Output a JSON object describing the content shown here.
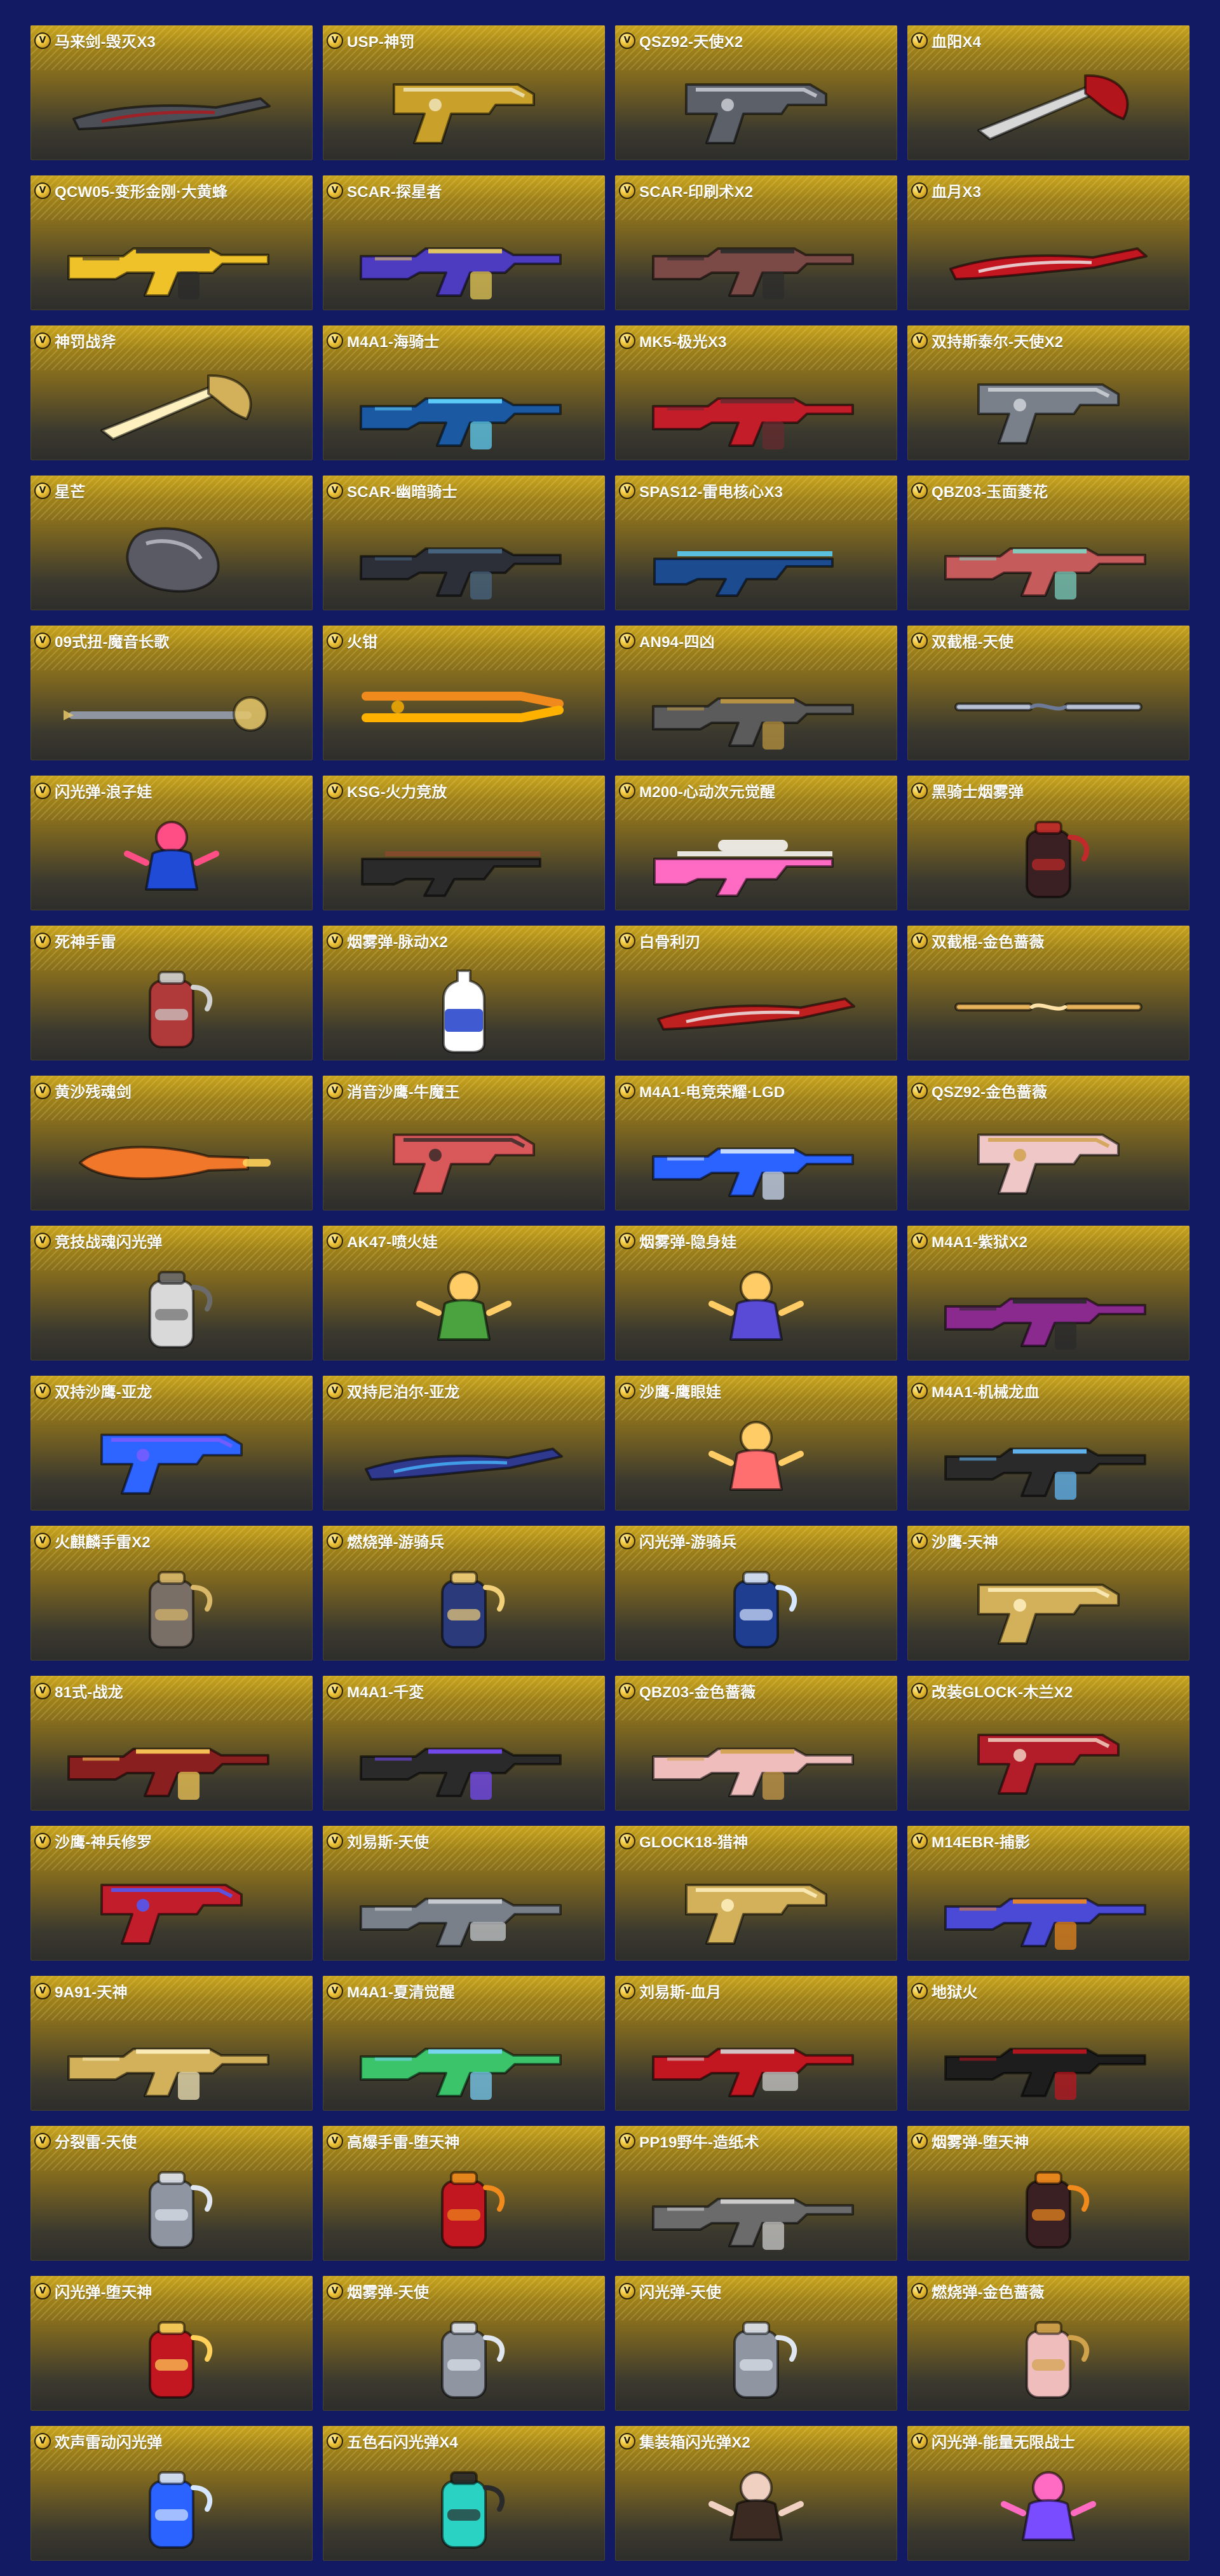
{
  "items": [
    {
      "name": "马来剑-毁灭X3",
      "icon": "blade-icon",
      "colors": [
        "#4d4f57",
        "#b1161b"
      ]
    },
    {
      "name": "USP-神罚",
      "icon": "pistol-icon",
      "colors": [
        "#c8a02a",
        "#efe4b9"
      ]
    },
    {
      "name": "QSZ92-天使X2",
      "icon": "pistol-icon",
      "colors": [
        "#5c6068",
        "#c9ccd2"
      ]
    },
    {
      "name": "血阳X4",
      "icon": "axe-icon",
      "colors": [
        "#b2151b",
        "#d7d7d7"
      ]
    },
    {
      "name": "QCW05-变形金刚·大黄蜂",
      "icon": "rifle-icon",
      "colors": [
        "#f0c22a",
        "#2a2a2a"
      ]
    },
    {
      "name": "SCAR-探星者",
      "icon": "rifle-icon",
      "colors": [
        "#4d3cbf",
        "#f0d25a"
      ]
    },
    {
      "name": "SCAR-印刷术X2",
      "icon": "rifle-icon",
      "colors": [
        "#7b4a46",
        "#2b2b2b"
      ]
    },
    {
      "name": "血月X3",
      "icon": "blade-icon",
      "colors": [
        "#c21620",
        "#f0f0f0"
      ]
    },
    {
      "name": "神罚战斧",
      "icon": "axe-icon",
      "colors": [
        "#d2b15a",
        "#fff1bf"
      ]
    },
    {
      "name": "M4A1-海骑士",
      "icon": "rifle-icon",
      "colors": [
        "#1b5aa3",
        "#63d7ff"
      ]
    },
    {
      "name": "MK5-极光X3",
      "icon": "rifle-icon",
      "colors": [
        "#c31d2a",
        "#6a2a2f"
      ]
    },
    {
      "name": "双持斯泰尔-天使X2",
      "icon": "pistol-icon",
      "colors": [
        "#7a808a",
        "#cfd3d8"
      ]
    },
    {
      "name": "星芒",
      "icon": "gauntlet-icon",
      "colors": [
        "#5a5a64",
        "#c8c8d2"
      ]
    },
    {
      "name": "SCAR-幽暗骑士",
      "icon": "rifle-icon",
      "colors": [
        "#2c2f37",
        "#4a6a86"
      ]
    },
    {
      "name": "SPAS12-雷电核心X3",
      "icon": "shotgun-icon",
      "colors": [
        "#1c4b8f",
        "#5ad4ff"
      ]
    },
    {
      "name": "QBZ03-玉面菱花",
      "icon": "rifle-icon",
      "colors": [
        "#c65b5b",
        "#7fd7c6"
      ]
    },
    {
      "name": "09式扭-魔音长歌",
      "icon": "staff-icon",
      "colors": [
        "#8f96a1",
        "#e6c76a"
      ]
    },
    {
      "name": "火钳",
      "icon": "tongs-icon",
      "colors": [
        "#f08a1d",
        "#ffb100"
      ]
    },
    {
      "name": "AN94-四凶",
      "icon": "rifle-icon",
      "colors": [
        "#5b5b5b",
        "#c09a42"
      ]
    },
    {
      "name": "双截棍-天使",
      "icon": "nunchaku-icon",
      "colors": [
        "#b8c1d4",
        "#6c7a98"
      ]
    },
    {
      "name": "闪光弹-浪子娃",
      "icon": "character-icon",
      "colors": [
        "#1f4bd6",
        "#ff4e86"
      ]
    },
    {
      "name": "KSG-火力竞放",
      "icon": "shotgun-icon",
      "colors": [
        "#2a2a2a",
        "#8a4a2d"
      ]
    },
    {
      "name": "M200-心动次元觉醒",
      "icon": "sniper-icon",
      "colors": [
        "#ff6bc2",
        "#ffffff"
      ]
    },
    {
      "name": "黑骑士烟雾弹",
      "icon": "grenade-icon",
      "colors": [
        "#3a2022",
        "#c12a2a"
      ]
    },
    {
      "name": "死神手雷",
      "icon": "grenade-icon",
      "colors": [
        "#b03a3a",
        "#d0d0d0"
      ]
    },
    {
      "name": "烟雾弹-脉动X2",
      "icon": "bottle-icon",
      "colors": [
        "#ffffff",
        "#1f3ec9"
      ]
    },
    {
      "name": "白骨利刃",
      "icon": "blade-icon",
      "colors": [
        "#bf2020",
        "#f0f0f0"
      ]
    },
    {
      "name": "双截棍-金色蔷薇",
      "icon": "nunchaku-icon",
      "colors": [
        "#e6b35b",
        "#ffe2a8"
      ]
    },
    {
      "name": "黄沙残魂剑",
      "icon": "sword-icon",
      "colors": [
        "#f1772a",
        "#ffd15a"
      ]
    },
    {
      "name": "消音沙鹰-牛魔王",
      "icon": "pistol-icon",
      "colors": [
        "#d9595a",
        "#3a2a2a"
      ]
    },
    {
      "name": "M4A1-电竞荣耀·LGD",
      "icon": "rifle-icon",
      "colors": [
        "#2a63ff",
        "#d7e6ff"
      ]
    },
    {
      "name": "QSZ92-金色蔷薇",
      "icon": "pistol-icon",
      "colors": [
        "#f0c7c7",
        "#d1a24c"
      ]
    },
    {
      "name": "竞技战魂闪光弹",
      "icon": "grenade-icon",
      "colors": [
        "#d9d9d9",
        "#6b6b6b"
      ]
    },
    {
      "name": "AK47-喷火娃",
      "icon": "character-icon",
      "colors": [
        "#4aa33e",
        "#ffcc66"
      ]
    },
    {
      "name": "烟雾弹-隐身娃",
      "icon": "character-icon",
      "colors": [
        "#5a4bd6",
        "#ffcc66"
      ]
    },
    {
      "name": "M4A1-紫狱X2",
      "icon": "rifle-icon",
      "colors": [
        "#8a2a8f",
        "#2a2a2a"
      ]
    },
    {
      "name": "双持沙鹰-亚龙",
      "icon": "pistol-icon",
      "colors": [
        "#2e64ff",
        "#7a5cff"
      ]
    },
    {
      "name": "双持尼泊尔-亚龙",
      "icon": "blade-icon",
      "colors": [
        "#2f3a8f",
        "#47b6ff"
      ]
    },
    {
      "name": "沙鹰-鹰眼娃",
      "icon": "character-icon",
      "colors": [
        "#ff6f6f",
        "#ffcc66"
      ]
    },
    {
      "name": "M4A1-机械龙血",
      "icon": "rifle-icon",
      "colors": [
        "#2a2a2a",
        "#67c0ff"
      ]
    },
    {
      "name": "火麒麟手雷X2",
      "icon": "grenade-icon",
      "colors": [
        "#7a6f66",
        "#d9b86a"
      ]
    },
    {
      "name": "燃烧弹-游骑兵",
      "icon": "grenade-icon",
      "colors": [
        "#2a3a7a",
        "#f2d07a"
      ]
    },
    {
      "name": "闪光弹-游骑兵",
      "icon": "grenade-icon",
      "colors": [
        "#1f3e8f",
        "#d6e6ff"
      ]
    },
    {
      "name": "沙鹰-天神",
      "icon": "pistol-icon",
      "colors": [
        "#d2b15a",
        "#fff1bf"
      ]
    },
    {
      "name": "81式-战龙",
      "icon": "rifle-icon",
      "colors": [
        "#8a1f1f",
        "#ffd15a"
      ]
    },
    {
      "name": "M4A1-千変",
      "icon": "rifle-icon",
      "colors": [
        "#2a2a2a",
        "#7a4cff"
      ]
    },
    {
      "name": "QBZ03-金色蔷薇",
      "icon": "rifle-icon",
      "colors": [
        "#f0bdbd",
        "#d1a24c"
      ]
    },
    {
      "name": "改装GLOCK-木兰X2",
      "icon": "pistol-icon",
      "colors": [
        "#b31d2a",
        "#f0d0c0"
      ]
    },
    {
      "name": "沙鹰-神兵修罗",
      "icon": "pistol-icon",
      "colors": [
        "#c21d2a",
        "#4a5cff"
      ]
    },
    {
      "name": "刘易斯-天使",
      "icon": "machine-gun-icon",
      "colors": [
        "#7a808a",
        "#cfd3d8"
      ]
    },
    {
      "name": "GLOCK18-猎神",
      "icon": "pistol-icon",
      "colors": [
        "#d2b15a",
        "#fff1bf"
      ]
    },
    {
      "name": "M14EBR-捕影",
      "icon": "rifle-icon",
      "colors": [
        "#4a4ad6",
        "#f08a1d"
      ]
    },
    {
      "name": "9A91-天神",
      "icon": "rifle-icon",
      "colors": [
        "#d2b15a",
        "#fff1bf"
      ]
    },
    {
      "name": "M4A1-夏清觉醒",
      "icon": "rifle-icon",
      "colors": [
        "#3cc46a",
        "#7fd7ff"
      ]
    },
    {
      "name": "刘易斯-血月",
      "icon": "machine-gun-icon",
      "colors": [
        "#c21620",
        "#d6d6d6"
      ]
    },
    {
      "name": "地狱火",
      "icon": "rifle-icon",
      "colors": [
        "#1d1d1d",
        "#c21620"
      ]
    },
    {
      "name": "分裂雷-天使",
      "icon": "grenade-icon",
      "colors": [
        "#8f96a1",
        "#e0e6f0"
      ]
    },
    {
      "name": "高爆手雷-堕天神",
      "icon": "grenade-icon",
      "colors": [
        "#c21620",
        "#f08a1d"
      ]
    },
    {
      "name": "PP19野牛-造纸术",
      "icon": "rifle-icon",
      "colors": [
        "#6b6b6b",
        "#d6d6d6"
      ]
    },
    {
      "name": "烟雾弹-堕天神",
      "icon": "grenade-icon",
      "colors": [
        "#3a2022",
        "#f08a1d"
      ]
    },
    {
      "name": "闪光弹-堕天神",
      "icon": "grenade-icon",
      "colors": [
        "#c21620",
        "#ffd15a"
      ]
    },
    {
      "name": "烟雾弹-天使",
      "icon": "grenade-icon",
      "colors": [
        "#8f96a1",
        "#e0e6f0"
      ]
    },
    {
      "name": "闪光弹-天使",
      "icon": "grenade-icon",
      "colors": [
        "#8f96a1",
        "#e0e6f0"
      ]
    },
    {
      "name": "燃烧弹-金色蔷薇",
      "icon": "grenade-icon",
      "colors": [
        "#f0bdbd",
        "#d1a24c"
      ]
    },
    {
      "name": "欢声雷动闪光弹",
      "icon": "grenade-icon",
      "colors": [
        "#2a63ff",
        "#d7e6ff"
      ]
    },
    {
      "name": "五色石闪光弹X4",
      "icon": "grenade-icon",
      "colors": [
        "#2ad2c3",
        "#2a2a2a"
      ]
    },
    {
      "name": "集装箱闪光弹X2",
      "icon": "character-icon",
      "colors": [
        "#3a2a22",
        "#f0d0c0"
      ]
    },
    {
      "name": "闪光弹-能量无限战士",
      "icon": "character-icon",
      "colors": [
        "#7a4cff",
        "#ff6bc2"
      ]
    }
  ]
}
